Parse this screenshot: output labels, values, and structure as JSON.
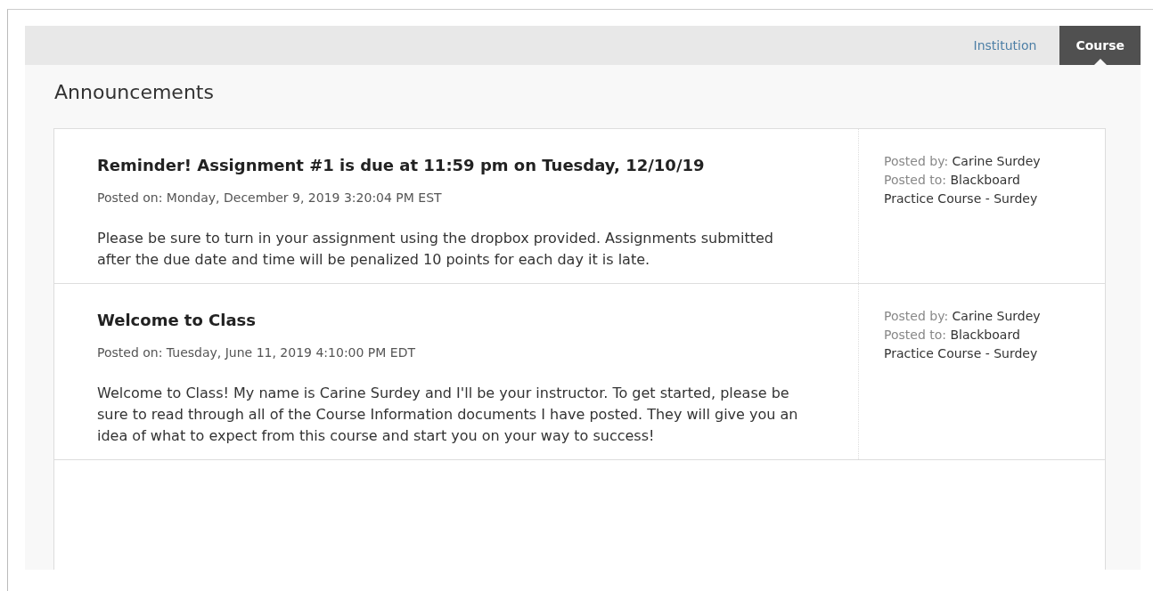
{
  "tabs": [
    {
      "label": "Institution",
      "selected": false
    },
    {
      "label": "Course",
      "selected": true
    }
  ],
  "title": "Announcements",
  "announcements": [
    {
      "title": "Reminder! Assignment #1 is due at 11:59 pm on Tuesday, 12/10/19",
      "posted_on": "Posted on: Monday, December 9, 2019 3:20:04 PM EST",
      "body": "Please be sure to turn in your assignment using the dropbox provided.  Assignments submitted after the due date and time will be penalized 10 points for each day it is late.",
      "posted_by": {
        "label": "Posted by:",
        "value": "Carine Surdey"
      },
      "posted_to": {
        "label": "Posted to:",
        "value": "Blackboard Practice Course - Surdey"
      }
    },
    {
      "title": "Welcome to Class",
      "posted_on": "Posted on: Tuesday, June 11, 2019 4:10:00 PM EDT",
      "body": "Welcome to Class!  My name is Carine Surdey and I'll be your instructor.  To get started, please be sure to read through all of the Course Information documents I have posted. They will give you an idea of what to expect from this course and start you on your way to success!",
      "posted_by": {
        "label": "Posted by:",
        "value": "Carine Surdey"
      },
      "posted_to": {
        "label": "Posted to:",
        "value": "Blackboard Practice Course - Surdey"
      }
    }
  ]
}
